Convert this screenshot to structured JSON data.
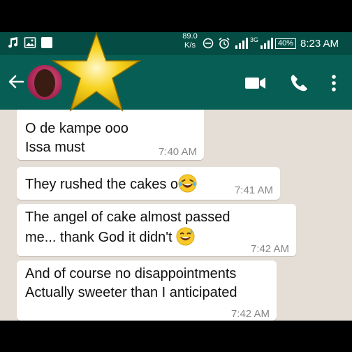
{
  "status_bar": {
    "network_speed_value": "89.0",
    "network_speed_unit": "K/s",
    "signal_label": "3G",
    "battery": "40%",
    "time": "8:23 AM"
  },
  "header": {
    "back_icon": "arrow-left-icon",
    "avatar": "contact-avatar",
    "actions": [
      "video-call-icon",
      "voice-call-icon",
      "more-options-icon"
    ]
  },
  "overlay": {
    "icon": "star-icon",
    "color": "#f3c700"
  },
  "messages": [
    {
      "lines": [
        "O de kampe ooo",
        "Issa must"
      ],
      "time": "7:40 AM"
    },
    {
      "lines": [
        "They rushed the cakes o"
      ],
      "time": "7:41 AM",
      "emoji": "laughing-face"
    },
    {
      "lines": [
        "The angel of cake almost passed",
        "me... thank God it didn't"
      ],
      "time": "7:42 AM",
      "emoji": "sweat-smile-face"
    },
    {
      "lines": [
        "And of course no disappointments",
        "Actually sweeter than I anticipated"
      ],
      "time": "7:42 AM"
    }
  ],
  "colors": {
    "header_bg": "#075e54",
    "statusbar_bg": "#054d44",
    "chat_bg": "#e5ded6",
    "bubble_bg": "#ffffff"
  }
}
